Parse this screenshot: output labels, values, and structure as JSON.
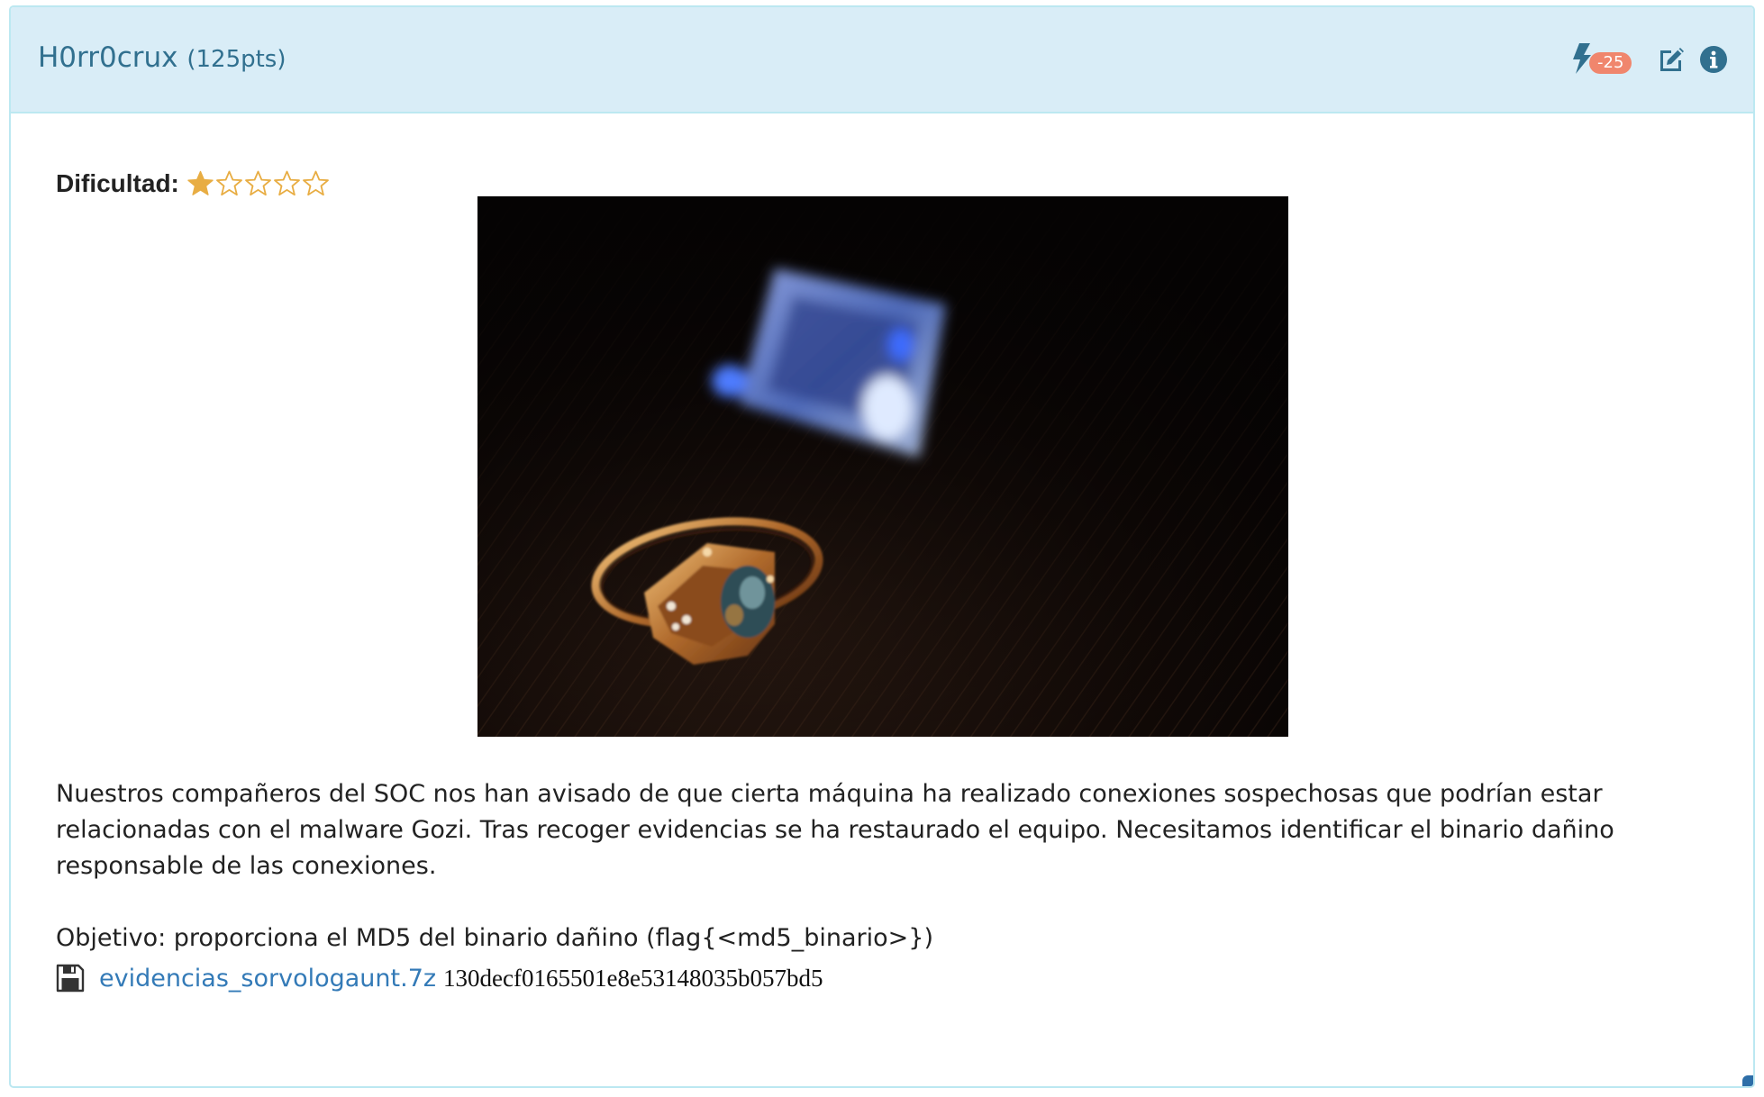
{
  "challenge": {
    "name": "H0rr0crux",
    "points": "(125pts)"
  },
  "header_actions": {
    "hint_icon": "bolt-icon",
    "hint_cost": "-25",
    "edit_icon": "edit-icon",
    "info_icon": "info-circle-icon"
  },
  "difficulty": {
    "label": "Dificultad:",
    "rating": 1,
    "max": 5
  },
  "description": "Nuestros compañeros del SOC nos han avisado de que cierta máquina ha realizado conexiones sospechosas que podrían estar relacionadas con el malware Gozi. Tras recoger evidencias se ha restaurado el equipo. Necesitamos identificar el binario dañino responsable de las conexiones.",
  "objective": "Objetivo: proporciona el MD5 del binario dañino (flag{<md5_binario>})",
  "attachment": {
    "icon": "floppy-disk-icon",
    "filename": "evidencias_sorvologaunt.7z",
    "md5": "130decf0165501e8e53148035b057bd5"
  },
  "colors": {
    "heading_bg": "#d9edf7",
    "heading_border": "#bce8f1",
    "title": "#31708f",
    "link": "#337ab7",
    "badge": "#f0866d",
    "star": "#e8ad43"
  }
}
